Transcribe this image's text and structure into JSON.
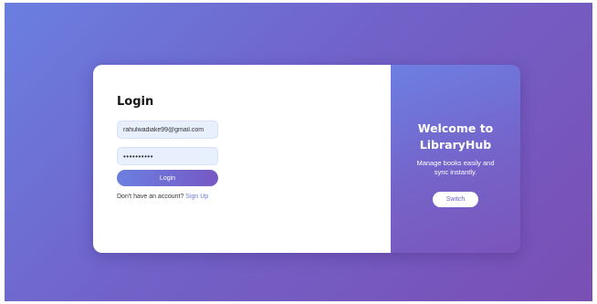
{
  "login_panel": {
    "title": "Login",
    "email_value": "rahulwadiake99@gmail.com",
    "password_value": "••••••••••",
    "login_button": "Login",
    "signup_prompt": "Don't have an account?",
    "signup_link": "Sign Up"
  },
  "welcome_panel": {
    "heading_line1": "Welcome to",
    "heading_line2": "LibraryHub",
    "tagline": "Manage books easily and sync instantly.",
    "switch_button": "Switch"
  },
  "colors": {
    "gradient_start": "#6a7fe0",
    "gradient_end": "#7a4fb4",
    "input_fill": "#e8f0fd",
    "link": "#6a7fe0"
  }
}
